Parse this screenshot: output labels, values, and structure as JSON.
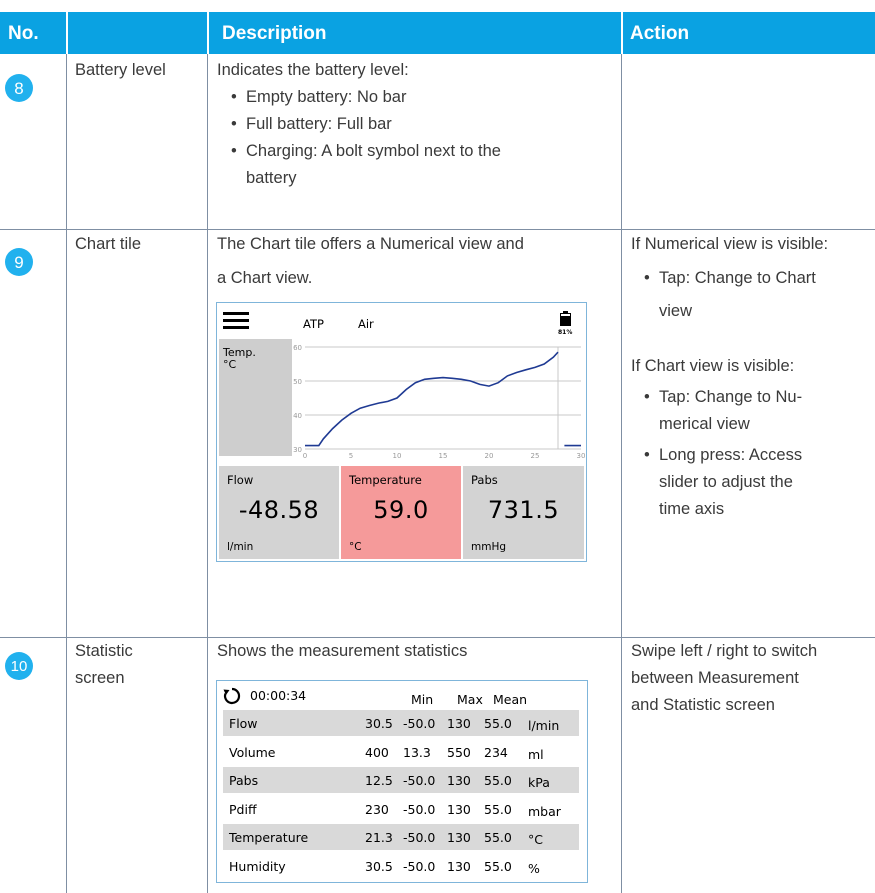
{
  "header": {
    "col_no": "No.",
    "col_description": "Description",
    "col_action": "Action",
    "bg_color": "#0aa2e2"
  },
  "rows": [
    {
      "number": "8",
      "name": "Battery level",
      "description": "Indicates the battery level:",
      "bullets": [
        "Empty battery: No bar",
        "Full battery: Full bar",
        "Charging: A bolt symbol next to the",
        "battery"
      ],
      "action": ""
    },
    {
      "number": "9",
      "name": "Chart tile",
      "description_lines": [
        "The Chart tile offers a Numerical view and",
        "a Chart view."
      ],
      "action_intro_1": "If Numerical view is visible:",
      "action_bullets_1": [
        "Tap: Change to Chart",
        "view"
      ],
      "action_intro_2": "If Chart view is visible:",
      "action_bullets_2": [
        "Tap: Change to Nu-",
        "merical view",
        "Long press: Access",
        "slider to adjust the",
        "time axis"
      ]
    },
    {
      "number": "10",
      "name_lines": [
        "Statistic",
        "screen"
      ],
      "description": "Shows the measurement statistics",
      "action_lines": [
        "Swipe left / right to switch",
        "between Measurement",
        "and Statistic screen"
      ]
    }
  ],
  "chart_screen": {
    "menu_icon": "hamburger-icon",
    "mode": "ATP",
    "gas": "Air",
    "battery_percent": "81%",
    "battery_level": 0.81,
    "temp_label_1": "Temp.",
    "temp_label_2": "°C",
    "tiles": [
      {
        "label": "Flow",
        "value": "-48.58",
        "unit": "l/min",
        "color": "#d3d3d3"
      },
      {
        "label": "Temperature",
        "value": "59.0",
        "unit": "°C",
        "color": "#f59a9a"
      },
      {
        "label": "Pabs",
        "value": "731.5",
        "unit": "mmHg",
        "color": "#d3d3d3"
      }
    ]
  },
  "chart_data": {
    "type": "line",
    "title": "",
    "xlabel": "",
    "ylabel": "",
    "xlim": [
      0,
      30
    ],
    "ylim": [
      30,
      60
    ],
    "x_ticks": [
      "0",
      "5",
      "10",
      "15",
      "20",
      "25",
      "30"
    ],
    "y_ticks": [
      "30",
      "40",
      "50",
      "60"
    ],
    "grid": true,
    "line_color": "#1f3a93",
    "series": [
      {
        "x": [
          0,
          1.5,
          2,
          3,
          4,
          5,
          6,
          7,
          8,
          9,
          10,
          11,
          12,
          13,
          14,
          15,
          16,
          17,
          18,
          19,
          20,
          21,
          22,
          23,
          24,
          25,
          26,
          27,
          27.5,
          28.2,
          30
        ],
        "y": [
          31,
          31,
          33,
          36,
          38.5,
          40.5,
          42,
          42.8,
          43.5,
          44,
          45,
          47.5,
          49.5,
          50.5,
          50.8,
          51,
          50.8,
          50.5,
          50,
          49,
          48.5,
          49.5,
          51.5,
          52.5,
          53.3,
          54,
          55,
          57,
          58.5,
          31,
          31
        ]
      }
    ]
  },
  "stat_screen": {
    "refresh_icon": "refresh-icon",
    "time": "00:00:34",
    "headers": [
      "Min",
      "Max",
      "Mean"
    ],
    "rows": [
      {
        "name": "Flow",
        "value": "30.5",
        "min": "-50.0",
        "max": "130",
        "mean": "55.0",
        "unit": "l/min"
      },
      {
        "name": "Volume",
        "value": "400",
        "min": "13.3",
        "max": "550",
        "mean": "234",
        "unit": "ml"
      },
      {
        "name": "Pabs",
        "value": "12.5",
        "min": "-50.0",
        "max": "130",
        "mean": "55.0",
        "unit": "kPa"
      },
      {
        "name": "Pdiff",
        "value": "230",
        "min": "-50.0",
        "max": "130",
        "mean": "55.0",
        "unit": "mbar"
      },
      {
        "name": "Temperature",
        "value": "21.3",
        "min": "-50.0",
        "max": "130",
        "mean": "55.0",
        "unit": "°C"
      },
      {
        "name": "Humidity",
        "value": "30.5",
        "min": "-50.0",
        "max": "130",
        "mean": "55.0",
        "unit": "%"
      }
    ]
  }
}
